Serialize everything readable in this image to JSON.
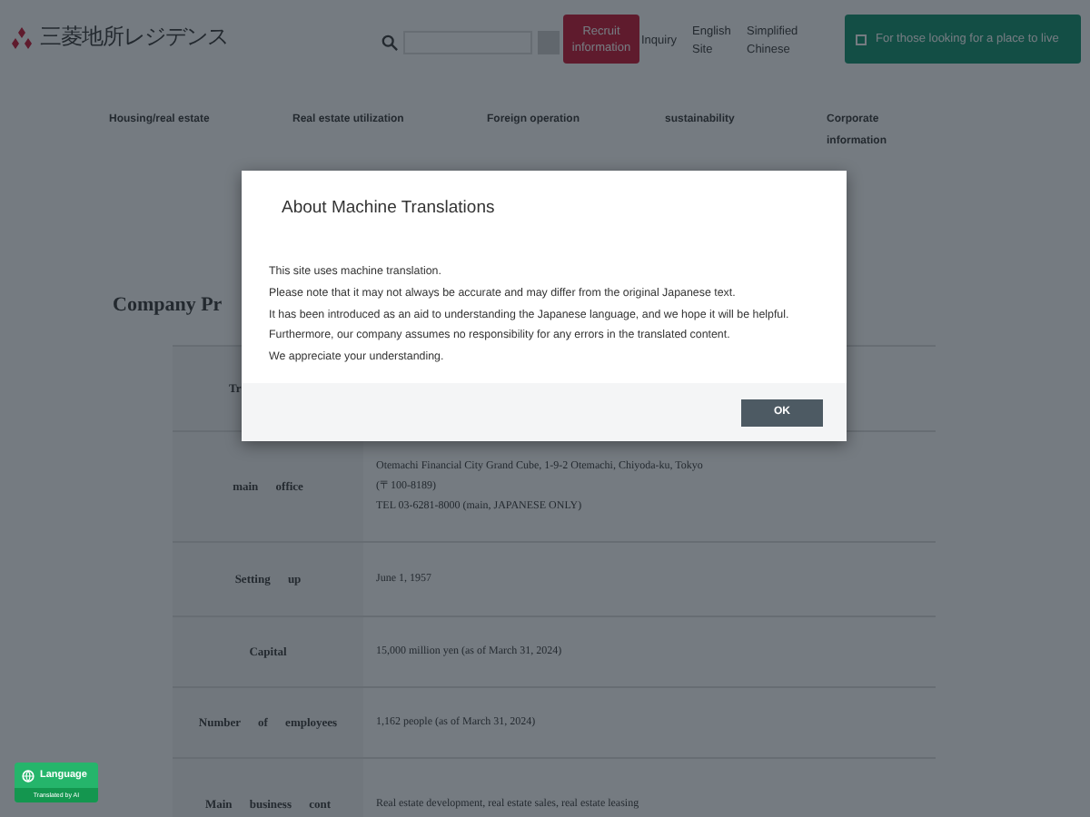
{
  "header": {
    "logo_text": "三菱地所レジデンス",
    "recruit_button": "Recruit information",
    "inquiry_link": "Inquiry",
    "language_links": [
      "English Site",
      "Simplified Chinese"
    ],
    "home_button": "For those looking for a place to live"
  },
  "nav": [
    "Housing/real estate",
    "Real estate utilization",
    "Foreign operation",
    "sustainability",
    "Corporate information"
  ],
  "page_title": "Company Pr",
  "profile_rows": [
    {
      "label": "Tr",
      "value": []
    },
    {
      "label": "main office",
      "value": [
        "Otemachi Financial City Grand Cube, 1-9-2 Otemachi, Chiyoda-ku, Tokyo",
        "(〒100-8189)",
        "TEL 03-6281-8000 (main, JAPANESE ONLY)"
      ]
    },
    {
      "label": "Setting up",
      "value": [
        "June 1, 1957"
      ]
    },
    {
      "label": "Capital",
      "value": [
        "15,000 million yen (as of March 31, 2024)"
      ]
    },
    {
      "label": "Number of employees",
      "value": [
        "1,162 people (as of March 31, 2024)"
      ]
    },
    {
      "label": "Main business cont",
      "value": [
        "Real estate development, real estate sales, real estate leasing"
      ]
    }
  ],
  "dialog": {
    "title": "About Machine Translations",
    "lines": [
      "This site uses machine translation.",
      "Please note that it may not always be accurate and may differ from the original Japanese text.",
      "It has been introduced as an aid to understanding the Japanese language, and we hope it will be helpful.",
      "Furthermore, our company assumes no responsibility for any errors in the translated content.",
      "We appreciate your understanding."
    ],
    "ok_button": "OK"
  },
  "language_widget": {
    "label": "Language",
    "note": "Translated by AI"
  }
}
